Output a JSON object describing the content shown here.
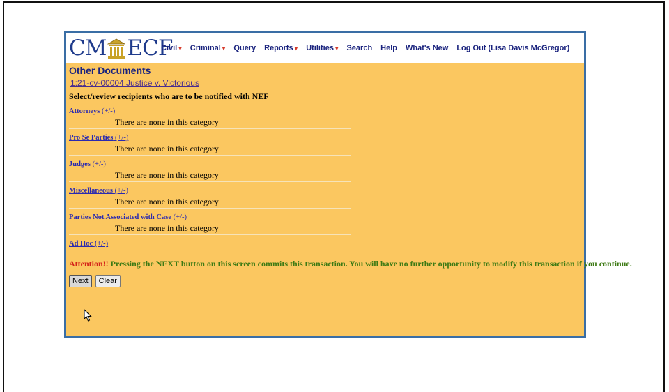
{
  "logo": {
    "left": "CM",
    "right": "ECF",
    "pillar_icon": "courthouse-pillar-icon"
  },
  "menu": [
    {
      "label": "Civil",
      "dropdown": true
    },
    {
      "label": "Criminal",
      "dropdown": true
    },
    {
      "label": "Query",
      "dropdown": false
    },
    {
      "label": "Reports",
      "dropdown": true
    },
    {
      "label": "Utilities",
      "dropdown": true
    },
    {
      "label": "Search",
      "dropdown": false
    },
    {
      "label": "Help",
      "dropdown": false
    },
    {
      "label": "What's New",
      "dropdown": false
    },
    {
      "label": "Log Out (Lisa Davis McGregor)",
      "dropdown": false
    }
  ],
  "page": {
    "title": "Other Documents",
    "case_link": "1:21-cv-00004 Justice v. Victorious",
    "instruction": "Select/review recipients who are to be notified with NEF"
  },
  "sections": [
    {
      "name": "Attorneys",
      "toggle": "(+/-)",
      "empty_text": "There are none in this category"
    },
    {
      "name": "Pro Se Parties",
      "toggle": "(+/-)",
      "empty_text": "There are none in this category"
    },
    {
      "name": "Judges",
      "toggle": "(+/-)",
      "empty_text": "There are none in this category"
    },
    {
      "name": "Miscellaneous",
      "toggle": "(+/-)",
      "empty_text": "There are none in this category"
    },
    {
      "name": "Parties Not Associated with Case",
      "toggle": "(+/-)",
      "empty_text": "There are none in this category"
    }
  ],
  "adhoc": {
    "name": "Ad Hoc",
    "toggle": "(+/-)"
  },
  "attention": {
    "label": "Attention!!",
    "message": " Pressing the NEXT button on this screen commits this transaction. You will have no further opportunity to modify this transaction if you continue."
  },
  "buttons": {
    "next": "Next",
    "clear": "Clear"
  },
  "colors": {
    "background": "#fbc760",
    "border": "#3a6ea5",
    "link": "#2a2ab0",
    "attention_red": "#d4221a",
    "attention_green": "#3d7a14",
    "menu_text": "#1a237e"
  }
}
